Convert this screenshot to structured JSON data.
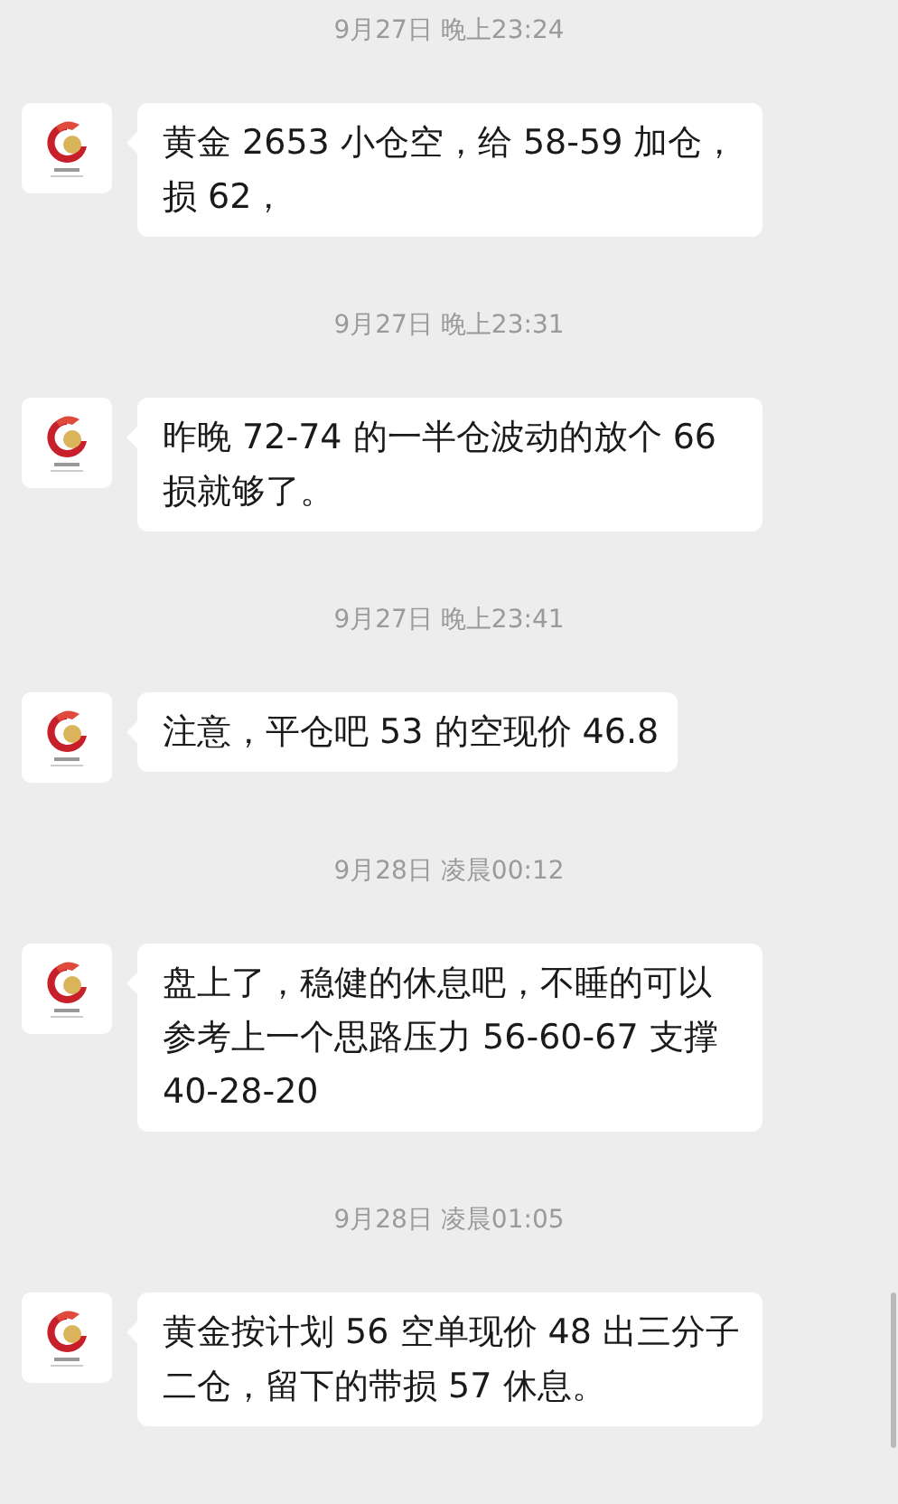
{
  "messages": [
    {
      "time": "9月27日 晚上23:24",
      "text": "黄金 2653 小仓空，给 58-59 加仓，损 62，"
    },
    {
      "time": "9月27日 晚上23:31",
      "text": "昨晚 72-74 的一半仓波动的放个 66 损就够了。"
    },
    {
      "time": "9月27日 晚上23:41",
      "text": "注意，平仓吧 53 的空现价 46.8"
    },
    {
      "time": "9月28日 凌晨00:12",
      "text": "盘上了，稳健的休息吧，不睡的可以参考上一个思路压力 56-60-67 支撑 40-28-20"
    },
    {
      "time": "9月28日 凌晨01:05",
      "text": "黄金按计划 56 空单现价 48 出三分子二仓，留下的带损 57 休息。"
    }
  ]
}
